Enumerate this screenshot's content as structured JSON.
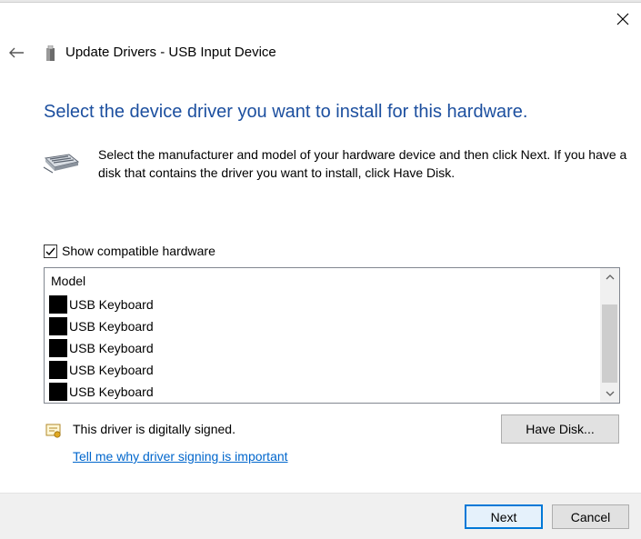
{
  "window": {
    "title": "Update Drivers - USB Input Device",
    "close_icon": "close-icon",
    "back_icon": "back-arrow-icon"
  },
  "main": {
    "heading": "Select the device driver you want to install for this hardware.",
    "instruction": "Select the manufacturer and model of your hardware device and then click Next. If you have a disk that contains the driver you want to install, click Have Disk.",
    "hardware_icon": "hardware-device-icon",
    "compatible_checkbox": {
      "label": "Show compatible hardware",
      "checked": true
    },
    "model_list": {
      "header": "Model",
      "items": [
        {
          "label": "USB Keyboard"
        },
        {
          "label": "USB Keyboard"
        },
        {
          "label": "USB Keyboard"
        },
        {
          "label": "USB Keyboard"
        },
        {
          "label": "USB Keyboard"
        }
      ]
    },
    "signed_text": "This driver is digitally signed.",
    "signed_icon": "certificate-icon",
    "signing_link": "Tell me why driver signing is important",
    "have_disk_label": "Have Disk..."
  },
  "footer": {
    "next_label": "Next",
    "cancel_label": "Cancel"
  },
  "colors": {
    "heading": "#1c4f9f",
    "link": "#0066cc",
    "default_button_border": "#0078d7"
  }
}
